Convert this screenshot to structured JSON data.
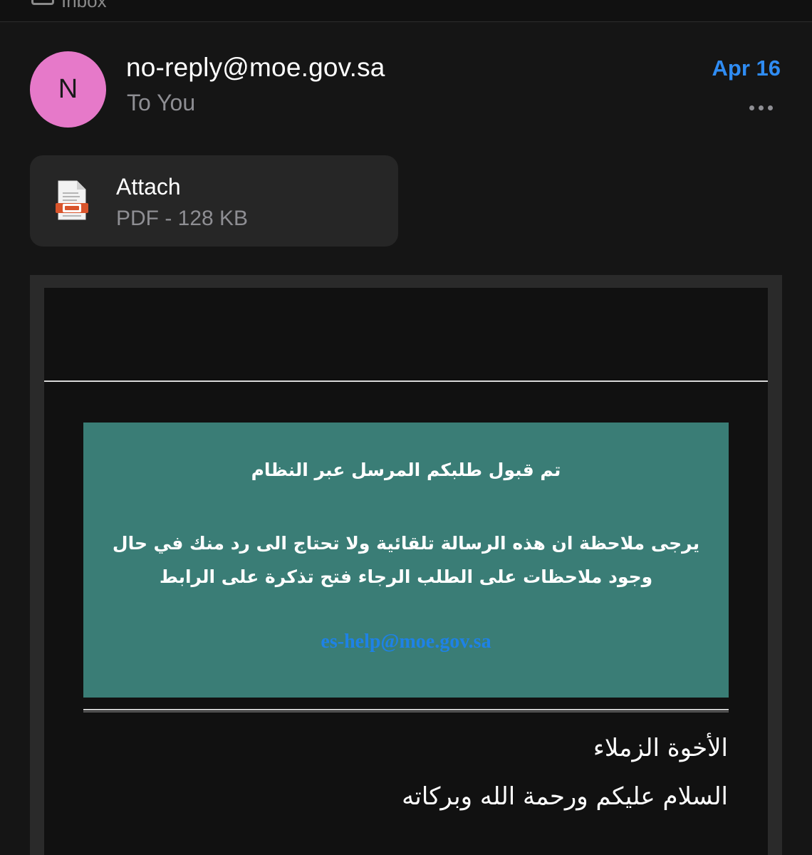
{
  "header": {
    "mailbox_label": "Inbox"
  },
  "message": {
    "avatar_initial": "N",
    "avatar_color": "#e679c9",
    "sender": "no-reply@moe.gov.sa",
    "recipient": "To You",
    "date": "Apr 16",
    "more_icon": "ellipsis-icon"
  },
  "attachment": {
    "icon": "pdf-file-icon",
    "name": "Attach",
    "meta": "PDF - 128 KB"
  },
  "body": {
    "notice_title": "تم قبول طلبكم المرسل عبر النظام",
    "notice_text": "يرجى ملاحظة ان هذه الرسالة تلقائية ولا تحتاج الى رد منك في حال وجود ملاحظات على الطلب الرجاء فتح تذكرة على الرابط",
    "notice_link": "es-help@moe.gov.sa",
    "notice_bg": "#3a7d76",
    "link_color": "#1e82e6",
    "greeting": "الأخوة الزملاء",
    "salutation": "السلام عليكم ورحمة الله وبركاته"
  },
  "colors": {
    "background": "#151515",
    "accent": "#2f8cf3",
    "secondary_text": "#8e8e93"
  }
}
